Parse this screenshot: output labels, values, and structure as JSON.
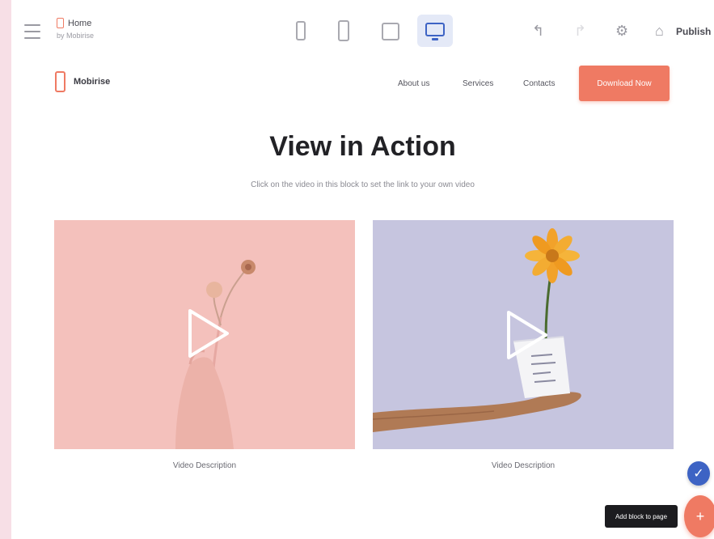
{
  "toolbar": {
    "site_title": "Home",
    "site_subtitle": "by Mobirise",
    "publish_label": "Publish",
    "device_icons": [
      "mobile-icon",
      "mobile-landscape-icon",
      "tablet-icon",
      "desktop-icon"
    ],
    "active_device": "desktop",
    "accent": "#3d63c4"
  },
  "site": {
    "brand": "Mobirise",
    "nav": [
      "About us",
      "Services",
      "Contacts"
    ],
    "cta_label": "Download Now",
    "brand_color": "#ef7a63"
  },
  "section": {
    "title": "View in Action",
    "subtitle": "Click on the video in this block to set the link to your own video",
    "videos": [
      {
        "caption": "Video Description",
        "bg": "#f3bdb8"
      },
      {
        "caption": "Video Description",
        "bg": "#c6c5df"
      }
    ]
  },
  "widgets": {
    "tooltip": "Add block to page",
    "check_icon": "check-icon",
    "add_icon": "plus-icon"
  }
}
